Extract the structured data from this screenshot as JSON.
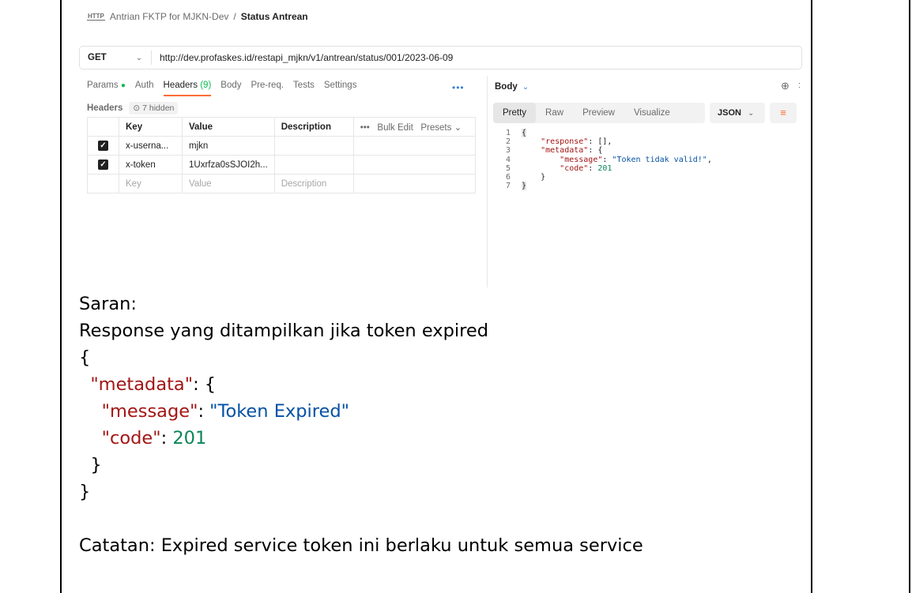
{
  "postman": {
    "breadcrumb": {
      "icon_text": "HTTP",
      "collection": "Antrian FKTP for MJKN-Dev",
      "separator": "/",
      "request": "Status Antrean"
    },
    "request": {
      "method": "GET",
      "url": "http://dev.profaskes.id/restapi_mjkn/v1/antrean/status/001/2023-06-09"
    },
    "request_tabs": {
      "params": "Params",
      "params_dot": "●",
      "auth": "Auth",
      "headers": "Headers",
      "headers_count": "(9)",
      "body": "Body",
      "prereq": "Pre-req.",
      "tests": "Tests",
      "settings": "Settings",
      "more": "•••"
    },
    "headers_section": {
      "label": "Headers",
      "hidden": "⊙ 7 hidden"
    },
    "headers_table": {
      "columns": {
        "key": "Key",
        "value": "Value",
        "description": "Description",
        "more": "•••",
        "bulk_edit": "Bulk Edit",
        "presets": "Presets ⌄"
      },
      "rows": [
        {
          "checked": "✓",
          "key": "x-userna...",
          "value": "mjkn",
          "description": ""
        },
        {
          "checked": "✓",
          "key": "x-token",
          "value": "1Uxrfza0sSJOI2h...",
          "description": ""
        }
      ],
      "placeholder": {
        "key": "Key",
        "value": "Value",
        "description": "Description"
      }
    },
    "response": {
      "body_label": "Body",
      "body_chev": "⌄",
      "tabs": {
        "pretty": "Pretty",
        "raw": "Raw",
        "preview": "Preview",
        "visualize": "Visualize"
      },
      "format": "JSON",
      "format_chev": "⌄",
      "wrap_icon": "≡",
      "globe_icon": "⊕",
      "more": ":",
      "code_lines": [
        {
          "n": "1",
          "text": "{"
        },
        {
          "n": "2",
          "key": "\"response\"",
          "rest": ": [],"
        },
        {
          "n": "3",
          "key": "\"metadata\"",
          "rest": ": {"
        },
        {
          "n": "4",
          "key": "\"message\"",
          "sep": ": ",
          "str": "\"Token tidak valid!\"",
          "tail": ","
        },
        {
          "n": "5",
          "key": "\"code\"",
          "sep": ": ",
          "num": "201"
        },
        {
          "n": "6",
          "text": "}"
        },
        {
          "n": "7",
          "text": "}"
        }
      ]
    }
  },
  "document": {
    "saran_label": "Saran:",
    "description": "Response yang ditampilkan jika token expired",
    "json": {
      "open": "{",
      "metadata_key": "\"metadata\"",
      "metadata_open": ": {",
      "message_key": "\"message\"",
      "message_sep": ": ",
      "message_value": "\"Token Expired\"",
      "code_key": "\"code\"",
      "code_sep": ": ",
      "code_value": "201",
      "inner_close": "}",
      "outer_close": "}"
    },
    "note": "Catatan: Expired service token ini berlaku untuk semua service"
  }
}
